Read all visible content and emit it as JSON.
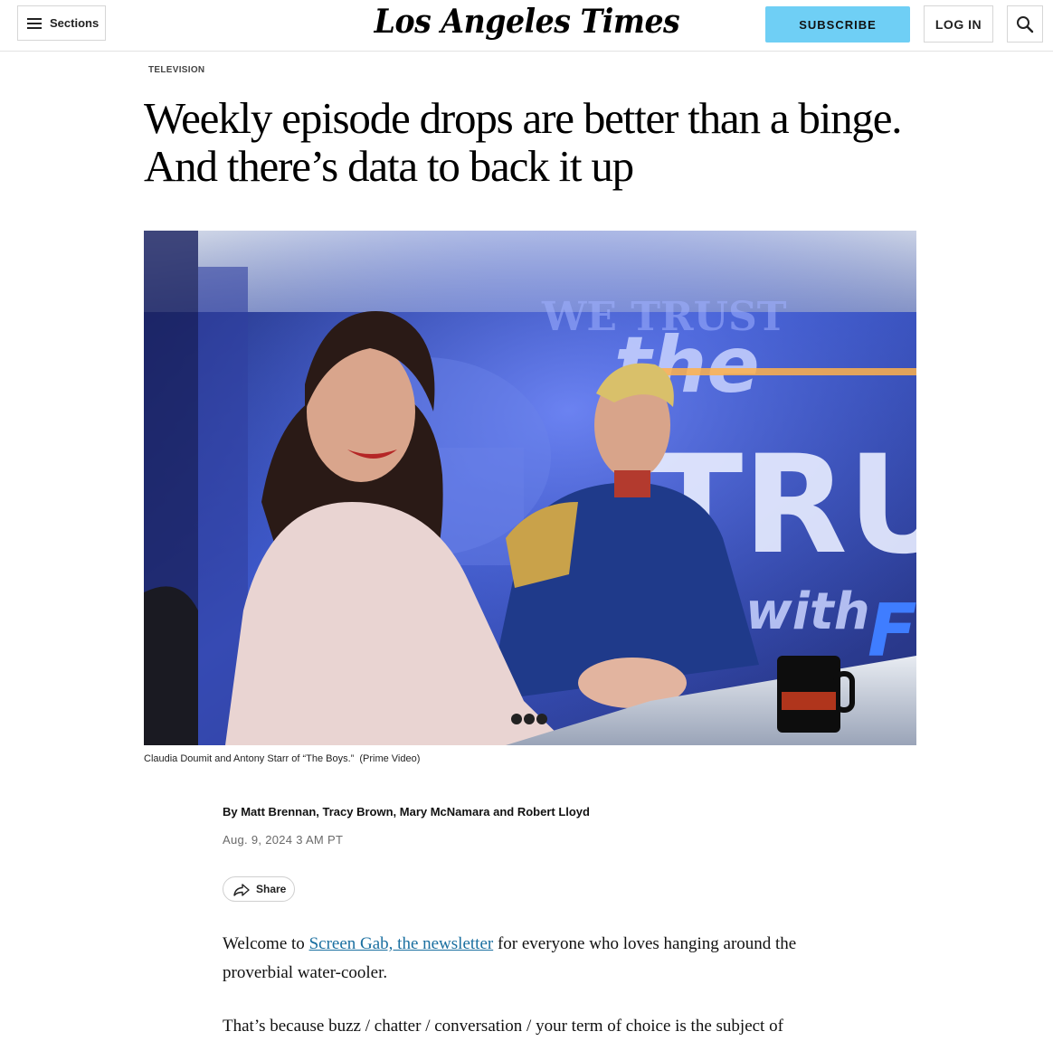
{
  "header": {
    "sections_label": "Sections",
    "logo_text": "Los Angeles Times",
    "subscribe_label": "SUBSCRIBE",
    "login_label": "LOG IN"
  },
  "article": {
    "kicker": "TELEVISION",
    "headline": "Weekly episode drops are better than a binge. And there’s data to back it up",
    "image": {
      "overlay_texts": [
        "WE TRUST",
        "the",
        "TRUTH",
        "with",
        "F"
      ],
      "caption": "Claudia Doumit and Antony Starr of “The Boys.”",
      "credit": "(Prime Video)"
    },
    "byline": "By Matt Brennan, Tracy Brown, Mary McNamara and Robert Lloyd",
    "date": "Aug. 9, 2024 3 AM PT",
    "share_label": "Share",
    "paragraph1": {
      "before_link": "Welcome to ",
      "link_text": "Screen Gab, the newsletter",
      "after_link": " for everyone who loves hanging around the proverbial water-cooler."
    },
    "paragraph2": "That’s because buzz / chatter / conversation / your term of choice is the subject of"
  },
  "colors": {
    "subscribe_bg": "#6fcff5",
    "link": "#1a6fa0",
    "hero_backdrop": "#2b3a8c"
  },
  "icons": {
    "menu": "hamburger-icon",
    "search": "search-icon",
    "share": "share-arrow-icon"
  }
}
